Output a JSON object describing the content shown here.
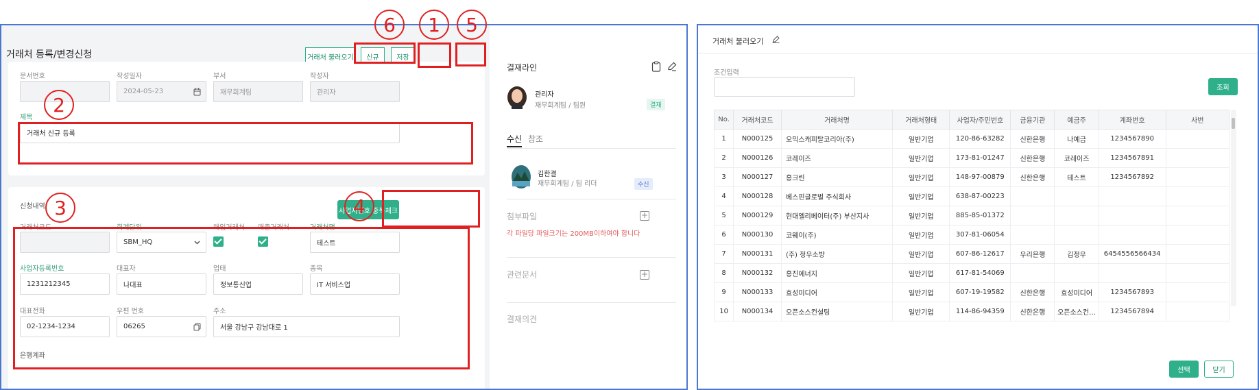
{
  "markers": [
    "6",
    "1",
    "5",
    "2",
    "3",
    "4"
  ],
  "left": {
    "title": "거래처 등록/변경신청",
    "toolbar": {
      "load_label": "거래처 불러오기",
      "new_label": "신규",
      "save_label": "저장"
    },
    "doc": {
      "doc_no_label": "문서번호",
      "doc_no_value": "",
      "date_label": "작성일자",
      "date_value": "2024-05-23",
      "dept_label": "부서",
      "dept_value": "재무회계팀",
      "author_label": "작성자",
      "author_value": "관리자",
      "subject_label": "제목",
      "subject_value": "거래처 신규 등록"
    },
    "apply": {
      "section_label": "신청내역",
      "dup_check_label": "사업자번호 중복체크",
      "code_label": "거래처코드",
      "code_value": "",
      "unit_label": "회계단위",
      "unit_value": "SBM_HQ",
      "purchase_label": "매입거래처",
      "sales_label": "매출거래처",
      "name_label": "거래처명",
      "name_value": "테스트",
      "bizno_label": "사업자등록번호",
      "bizno_value": "1231212345",
      "ceo_label": "대표자",
      "ceo_value": "나대표",
      "biztype_label": "업태",
      "biztype_value": "정보통신업",
      "item_label": "종목",
      "item_value": "IT 서비스업",
      "phone_label": "대표전화",
      "phone_value": "02-1234-1234",
      "zip_label": "우편 번호",
      "zip_value": "06265",
      "addr_label": "주소",
      "addr_value": "서울 강남구 강남대로 1",
      "bank_label": "은행계좌"
    },
    "approval": {
      "title": "결재라인",
      "approver_name": "관리자",
      "approver_dept": "재무회계팀 / 팀원",
      "approver_badge": "결재",
      "tab_receive": "수신",
      "tab_ref": "참조",
      "receiver_name": "김한결",
      "receiver_dept": "재무회계팀 / 팀 리더",
      "receiver_badge": "수신",
      "attach_title": "첨부파일",
      "attach_note": "각 파일당 파일크기는 200MB이하여야 합니다",
      "related_title": "관련문서",
      "opinion_title": "결재의견"
    },
    "colors": {
      "accent": "#2fb08a",
      "highlight": "#e02020",
      "frame": "#4a78d0"
    }
  },
  "right": {
    "title": "거래처 불러오기",
    "cond_label": "조건입력",
    "cond_value": "",
    "search_label": "조회",
    "columns": [
      "No.",
      "거래처코드",
      "거래처명",
      "거래처형태",
      "사업자/주민번호",
      "금융기관",
      "예금주",
      "계좌번호",
      "사번"
    ],
    "rows": [
      [
        "1",
        "N000125",
        "오믹스캐피탈코리아(주)",
        "일반기업",
        "120-86-63282",
        "신한은행",
        "나예금",
        "1234567890",
        ""
      ],
      [
        "2",
        "N000126",
        "코레이즈",
        "일반기업",
        "173-81-01247",
        "신한은행",
        "코레이즈",
        "1234567891",
        ""
      ],
      [
        "3",
        "N000127",
        "홍크린",
        "일반기업",
        "148-97-00879",
        "신한은행",
        "테스트",
        "1234567892",
        ""
      ],
      [
        "4",
        "N000128",
        "베스핀글로벌 주식회사",
        "일반기업",
        "638-87-00223",
        "",
        "",
        "",
        ""
      ],
      [
        "5",
        "N000129",
        "현대엘리베이터(주) 부산지사",
        "일반기업",
        "885-85-01372",
        "",
        "",
        "",
        ""
      ],
      [
        "6",
        "N000130",
        "코웨이(주)",
        "일반기업",
        "307-81-06054",
        "",
        "",
        "",
        ""
      ],
      [
        "7",
        "N000131",
        "(주) 정우소방",
        "일반기업",
        "607-86-12617",
        "우리은행",
        "김정우",
        "6454556566434",
        ""
      ],
      [
        "8",
        "N000132",
        "홍진에너지",
        "일반기업",
        "617-81-54069",
        "",
        "",
        "",
        ""
      ],
      [
        "9",
        "N000133",
        "효성미디어",
        "일반기업",
        "607-19-19582",
        "신한은행",
        "효성미디어",
        "1234567893",
        ""
      ],
      [
        "10",
        "N000134",
        "오픈소스컨설팅",
        "일반기업",
        "114-86-94359",
        "신한은행",
        "오픈소스컨…",
        "1234567894",
        ""
      ]
    ],
    "select_label": "선택",
    "close_label": "닫기"
  }
}
